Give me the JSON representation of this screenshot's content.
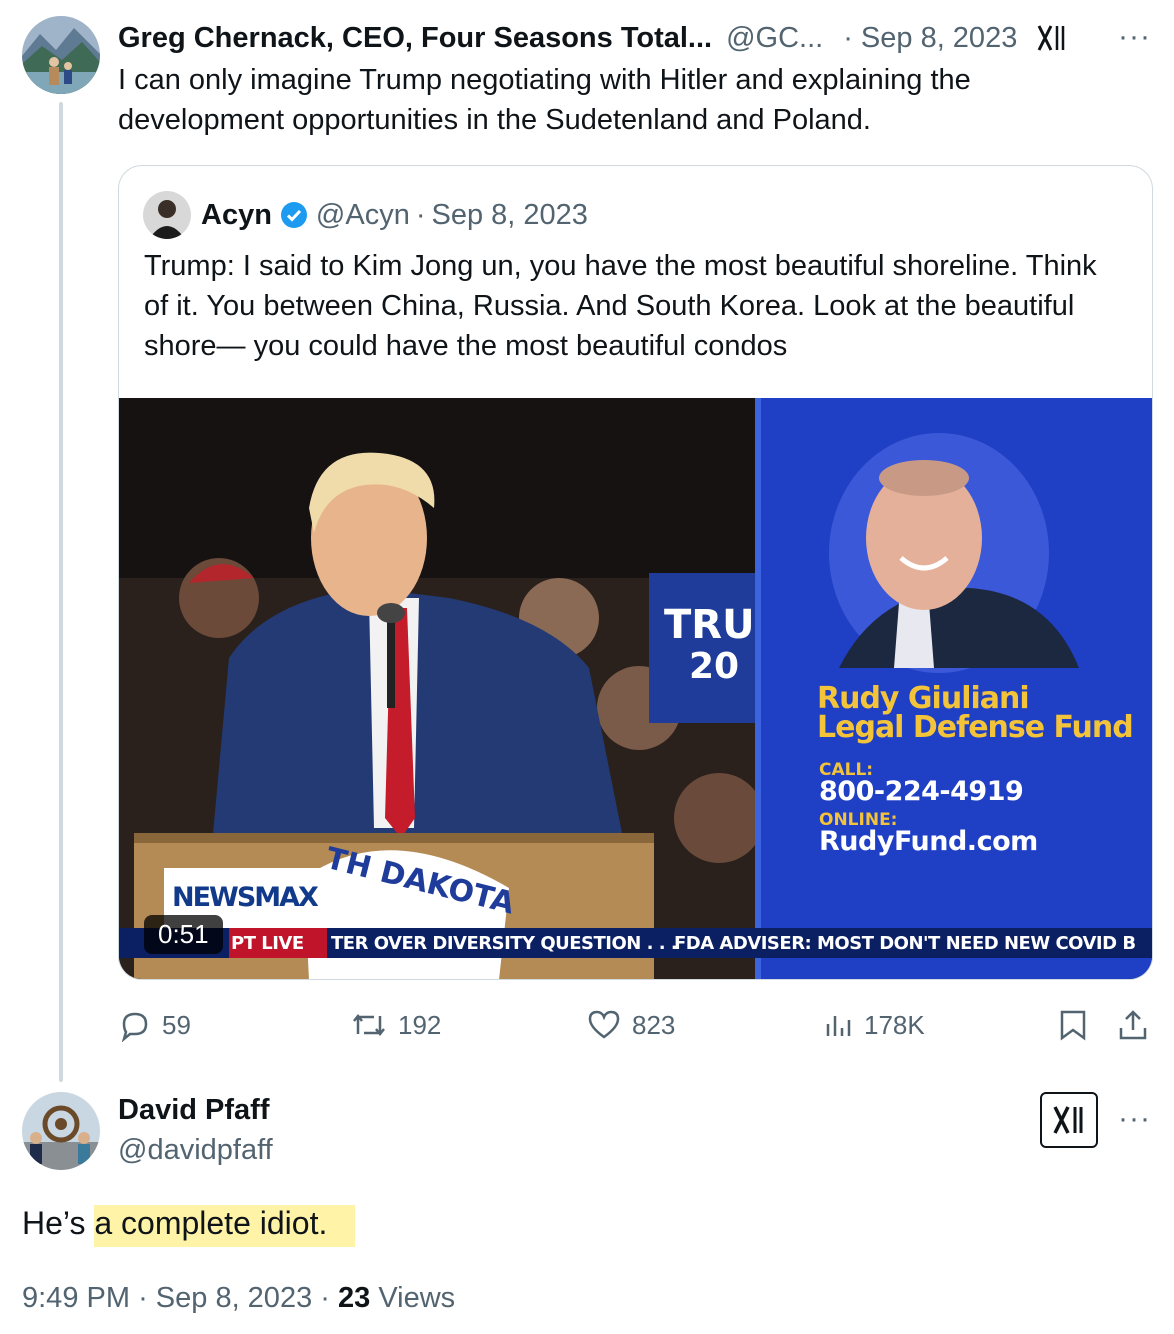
{
  "tweet1": {
    "author_name": "Greg Chernack, CEO, Four Seasons Total...",
    "handle": "@GC...",
    "date": "Sep 8, 2023",
    "text": "I can only imagine Trump negotiating with Hitler and explaining the development opportunities in the Sudetenland and Poland."
  },
  "quote": {
    "author_name": "Acyn",
    "handle": "@Acyn",
    "date": "Sep 8, 2023",
    "text": "Trump: I said to Kim Jong un,  you have the most beautiful shoreline. Think of it. You between China, Russia. And South Korea. Look at the beautiful shore— you could have the most beautiful condos",
    "video": {
      "duration": "0:51",
      "fund_title_1": "Rudy Giuliani",
      "fund_title_2": "Legal Defense Fund",
      "call_label": "CALL:",
      "phone": "800-224-4919",
      "online_label": "ONLINE:",
      "website": "RudyFund.com",
      "logo": "NEWSMAX",
      "ticker_live": "PT   LIVE",
      "ticker_1": "TER OVER DIVERSITY QUESTION . . .",
      "ticker_2": "FDA ADVISER: MOST DON'T NEED NEW COVID B",
      "sign_text_1": "TRU",
      "sign_text_2": "20",
      "podium_text": "TH DAKOTA"
    }
  },
  "actions": {
    "replies": "59",
    "reposts": "192",
    "likes": "823",
    "views": "178K"
  },
  "tweet2": {
    "author_name": "David Pfaff",
    "handle": "@davidpfaff",
    "text_prefix": "He’s ",
    "text_highlight": "a complete idiot.",
    "time": "9:49 PM",
    "date": "Sep 8, 2023",
    "views_count": "23",
    "views_label": "Views"
  },
  "colors": {
    "text_primary": "#0f1419",
    "text_secondary": "#536471",
    "verified": "#1d9bf0",
    "highlight": "#fff3a8",
    "fund_gold": "#f3c33a"
  }
}
